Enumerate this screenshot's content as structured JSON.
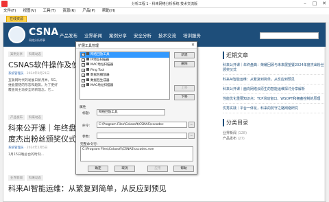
{
  "window": {
    "title": "分析工程 1 - 科来网络分析系统 技术交流版"
  },
  "menubar": [
    "文件(F)",
    "视图(V)",
    "工具(T)",
    "资源(R)",
    "产品(P)",
    "帮助(H)"
  ],
  "tab": {
    "label": "在线资源"
  },
  "site": {
    "logo_text": "CSNA",
    "logo_sub": "网络分析师事",
    "nav": [
      "产品发布",
      "业界新闻",
      "案例分享",
      "安全分析",
      "技术交流",
      "培训服务"
    ],
    "articles": [
      {
        "tags": [
          "案例分享",
          "科来动态"
        ],
        "title": "CSNAS软件操作及使",
        "meta_author": "系统管理员",
        "meta_date": "2024年9月21日",
        "excerpt": [
          "互联网时代的发展日新月异，5G、",
          "维能量链的形态和趋势。为了更好",
          "覆盖向主动安全的新理念，它..."
        ]
      },
      {
        "tags": [
          "产品发布",
          "科来动态"
        ],
        "title": "科来公开课｜年终盘典",
        "title2": "度杰出粉丝颁奖仪式",
        "meta_author": "系统管理员",
        "meta_date": "2024年1月5日",
        "excerpt": [
          "1月15日晚总台的时刻..."
        ]
      },
      {
        "tags": [
          "业界新闻",
          "科来动态"
        ],
        "title": "科来AI智能运维：从繁复到简单，从反应到预见",
        "meta_author": "",
        "meta_date": "",
        "excerpt": []
      }
    ],
    "sidebar": {
      "recent_title": "近期文章",
      "recent": [
        "科来公开课｜年终盘典：荣耀回顾与未来展望暨2024年度杰出粉丝颁奖仪式",
        "科来AI智能运维：从繁复到简单，从反应到预见",
        "科来公开课｜面向网络云原生的智能运维探讨分享解析",
        "性能优化重要知识点：TCP滑动窗口、WSOPT和拥塞控制的原理",
        "优秀实践｜平台一体化，科来的防守之路网络研究"
      ],
      "categories_title": "分类目录",
      "categories": [
        {
          "name": "业界新闻",
          "count": "(128)"
        },
        {
          "name": "产品发布",
          "count": "(27)"
        }
      ]
    }
  },
  "dialog": {
    "title": "扩展工具管理",
    "close_glyph": "✕",
    "tools": [
      {
        "name": "网络回放工具",
        "selected": true
      },
      {
        "name": "IP地址扫描器",
        "selected": false
      },
      {
        "name": "MAC地址扫描器",
        "selected": false
      },
      {
        "name": "Ping Tool",
        "selected": false
      },
      {
        "name": "数据包播放器",
        "selected": false
      },
      {
        "name": "数据包生成器",
        "selected": false
      },
      {
        "name": "MAC地址扫描器",
        "selected": false
      }
    ],
    "buttons": {
      "new": "新建",
      "delete": "删除",
      "up": "上移",
      "down": "下移",
      "ok": "确定",
      "cancel": "取消",
      "apply": "应用",
      "help": "帮助"
    },
    "props_label": "属性",
    "title_label": "标题:",
    "title_value": "网络回放工具",
    "command_label": "命令:",
    "command_value": "C:\\Program Files\\Colasoft\\CSNAS\\cscodec",
    "args_label": "参数:",
    "args_value": "",
    "cmdline_label": "完整命令行:",
    "cmdline_value": "C:\\Program Files\\Colasoft\\CSNAS\\cscodec.exe",
    "browse_glyph": "...",
    "check_glyph": "✓"
  }
}
